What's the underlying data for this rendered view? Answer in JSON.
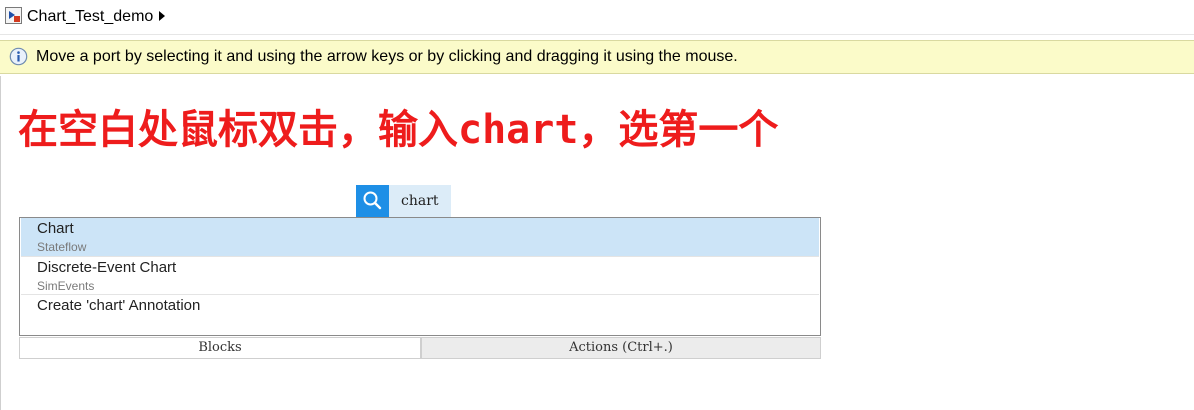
{
  "window": {
    "breadcrumb": "Chart_Test_demo"
  },
  "infobar": {
    "message": "Move a port by selecting it and using the arrow keys or by clicking and dragging it using the mouse."
  },
  "annotation": {
    "text": "在空白处鼠标双击，输入chart，选第一个",
    "color": "#ee1c1c"
  },
  "search": {
    "value": "chart",
    "button_color": "#1e8fe6",
    "icon": "search-icon"
  },
  "results": [
    {
      "title": "Chart",
      "subtitle": "Stateflow",
      "selected": true
    },
    {
      "title": "Discrete-Event Chart",
      "subtitle": "SimEvents",
      "selected": false
    },
    {
      "title": "Create 'chart' Annotation",
      "subtitle": "",
      "selected": false
    }
  ],
  "tabs": {
    "blocks": "Blocks",
    "actions": "Actions (Ctrl+.)"
  }
}
